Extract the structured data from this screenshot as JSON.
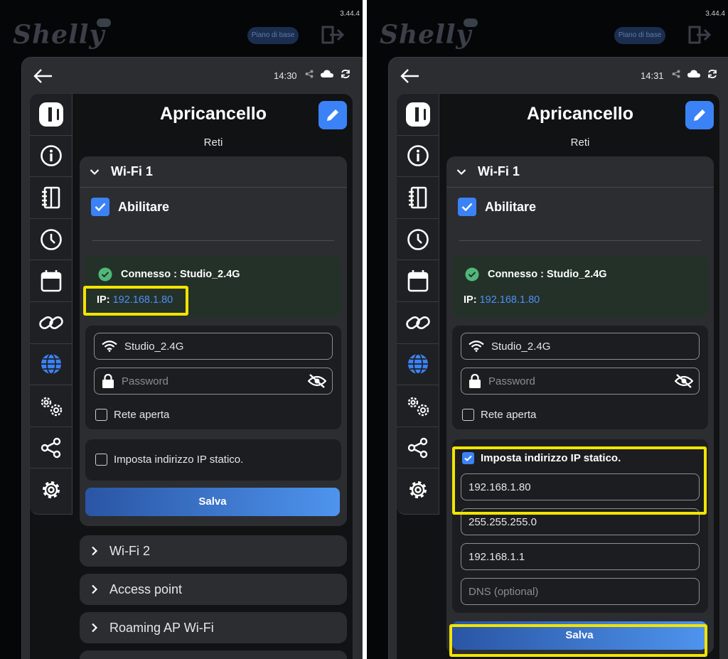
{
  "app": {
    "version": "3.44.4",
    "logo": "Shelly",
    "plan_label": "Piano di base"
  },
  "colors": {
    "accent": "#3b82f6",
    "highlight": "#f2e400",
    "connected": "#4fb878",
    "ip_link": "#4f8ef7"
  },
  "left": {
    "time": "14:30",
    "device_title": "Apricancello",
    "section": "Reti",
    "wifi1": {
      "header": "Wi-Fi 1",
      "enable_label": "Abilitare",
      "connected_text": "Connesso : Studio_2.4G",
      "ip_label": "IP:",
      "ip_value": "192.168.1.80",
      "ssid": "Studio_2.4G",
      "password_placeholder": "Password",
      "open_network_label": "Rete aperta",
      "static_ip_label": "Imposta indirizzo IP statico.",
      "save_label": "Salva"
    },
    "other_sections": [
      "Wi-Fi 2",
      "Access point",
      "Roaming AP Wi-Fi"
    ]
  },
  "right": {
    "time": "14:31",
    "device_title": "Apricancello",
    "section": "Reti",
    "wifi1": {
      "header": "Wi-Fi 1",
      "enable_label": "Abilitare",
      "connected_text": "Connesso : Studio_2.4G",
      "ip_label": "IP:",
      "ip_value": "192.168.1.80",
      "ssid": "Studio_2.4G",
      "password_placeholder": "Password",
      "open_network_label": "Rete aperta",
      "static_ip_label": "Imposta indirizzo IP statico.",
      "static_ip": "192.168.1.80",
      "netmask": "255.255.255.0",
      "gateway": "192.168.1.1",
      "dns_placeholder": "DNS (optional)",
      "save_label": "Salva"
    }
  },
  "sidebar_icons": [
    "device-icon",
    "info-icon",
    "notebook-icon",
    "clock-icon",
    "calendar-icon",
    "link-icon",
    "globe-icon",
    "gears-icon",
    "share-icon",
    "settings-icon"
  ]
}
